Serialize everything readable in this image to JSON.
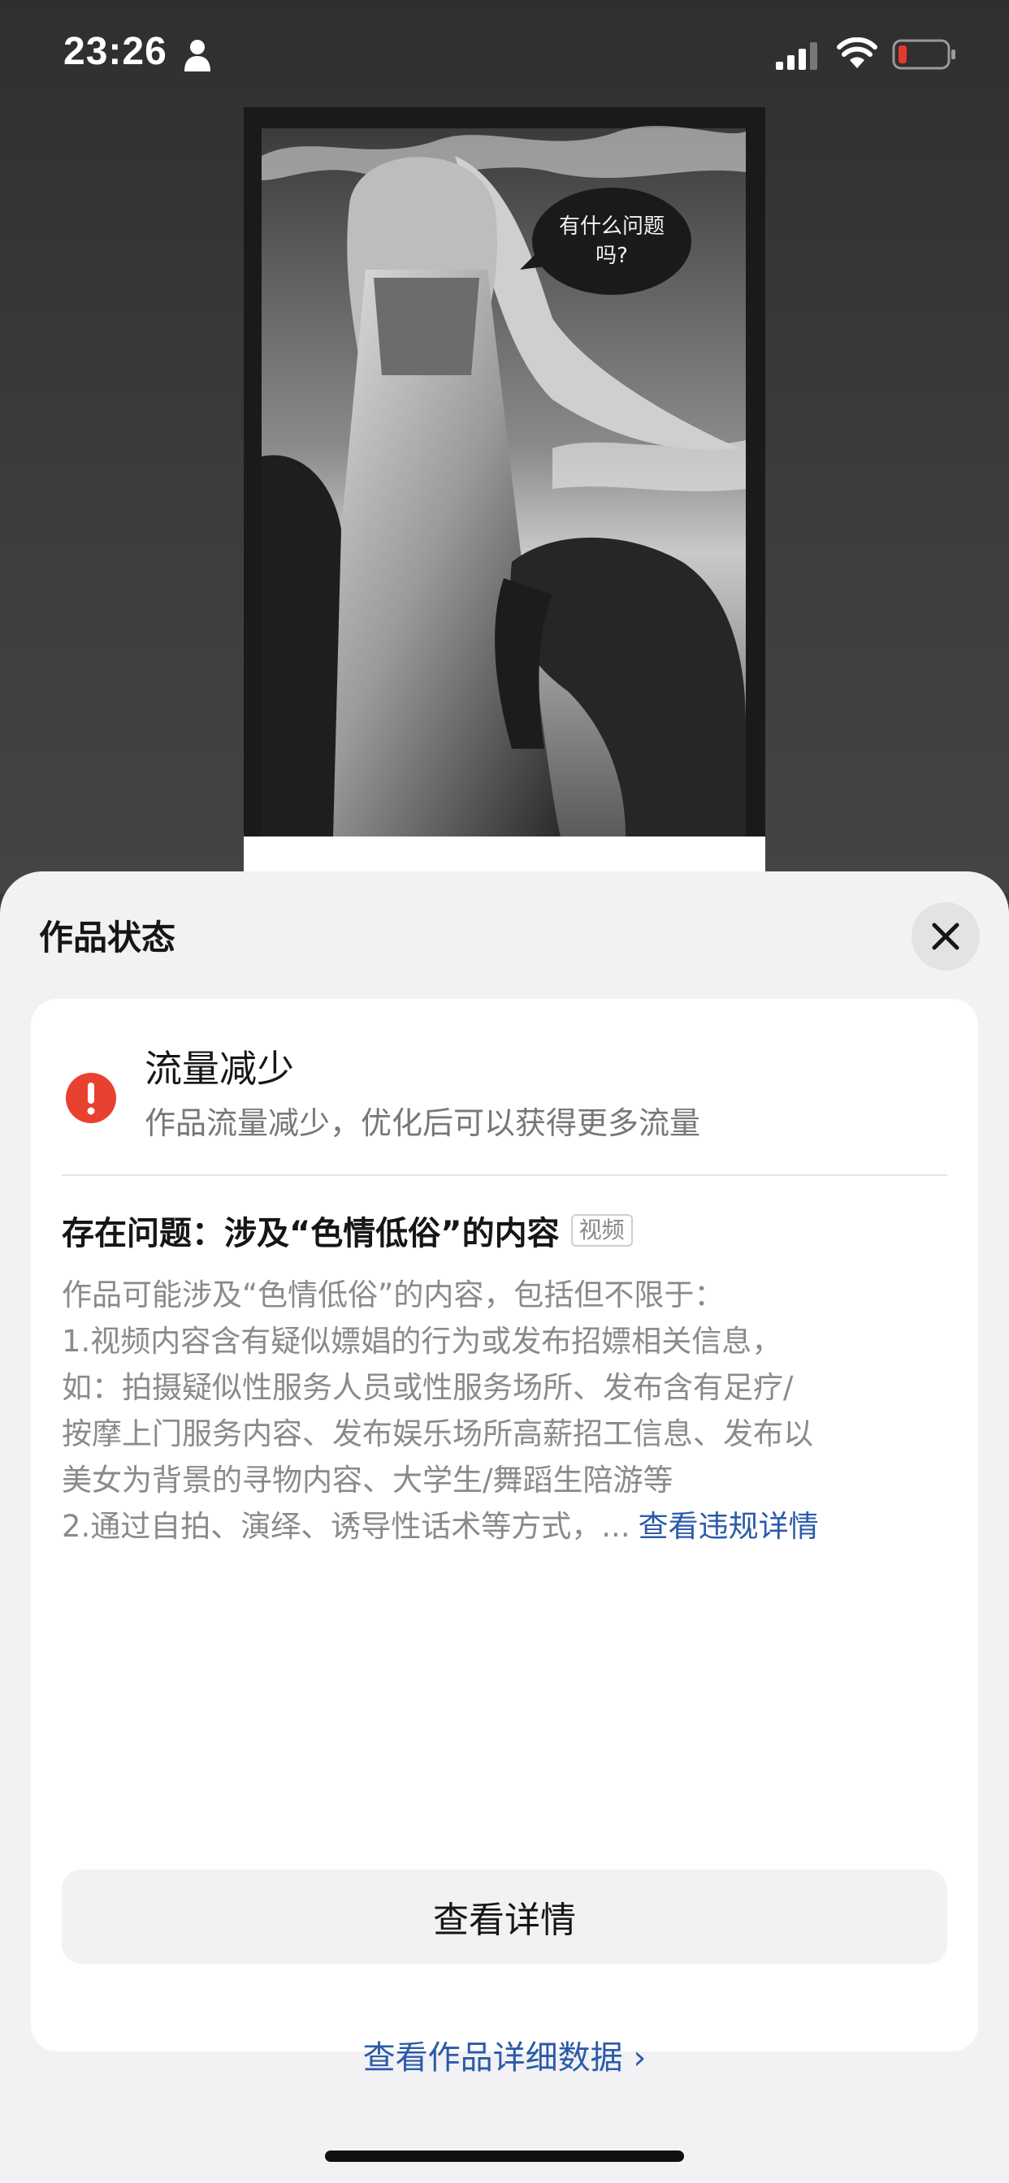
{
  "status_bar": {
    "time": "23:26",
    "icons": [
      "person-icon",
      "signal-icon",
      "wifi-icon",
      "battery-low-icon"
    ],
    "battery_color": "#e5392f"
  },
  "artwork": {
    "speech_bubble": "有什么问题吗?"
  },
  "sheet": {
    "title": "作品状态",
    "close_icon": "close-icon",
    "status": {
      "icon": "warning-icon",
      "icon_color": "#e8412f",
      "heading": "流量减少",
      "description": "作品流量减少，优化后可以获得更多流量"
    },
    "issue": {
      "title": "存在问题：涉及“色情低俗”的内容",
      "tag": "视频",
      "lines": [
        "作品可能涉及“色情低俗”的内容，包括但不限于：",
        "1.视频内容含有疑似嫖娼的行为或发布招嫖相关信息，",
        "如：拍摄疑似性服务人员或性服务场所、发布含有足疗/",
        "按摩上门服务内容、发布娱乐场所高薪招工信息、发布以",
        "美女为背景的寻物内容、大学生/舞蹈生陪游等"
      ],
      "last_line": "2.通过自拍、演绎、诱导性话术等方式，...",
      "more_link": "查看违规详情"
    },
    "detail_button": "查看详情",
    "data_link": "查看作品详细数据 ›",
    "link_color": "#2b5ba8"
  }
}
